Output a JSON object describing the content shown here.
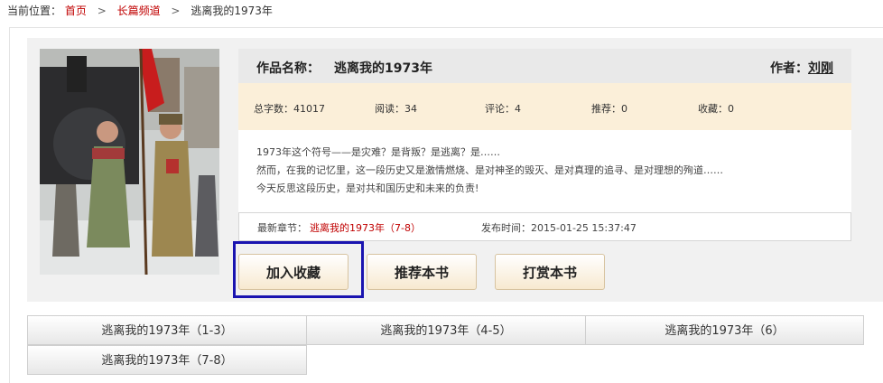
{
  "breadcrumb": {
    "label": "当前位置：",
    "home": "首页",
    "channel": "长篇频道",
    "separator": ">",
    "current": "逃离我的1973年"
  },
  "book": {
    "title_label": "作品名称：",
    "title": "逃离我的1973年",
    "author_label": "作者：",
    "author": "刘刚",
    "stats": [
      {
        "label": "总字数：",
        "value": "41017"
      },
      {
        "label": "阅读：",
        "value": "34"
      },
      {
        "label": "评论：",
        "value": "4"
      },
      {
        "label": "推荐：",
        "value": "0"
      },
      {
        "label": "收藏：",
        "value": "0"
      }
    ],
    "description": [
      "1973年这个符号——是灾难？是背叛？是逃离？是……",
      "然而，在我的记忆里，这一段历史又是激情燃烧、是对神圣的毁灭、是对真理的追寻、是对理想的殉道……",
      "今天反思这段历史，是对共和国历史和未来的负责!"
    ],
    "latest_label": "最新章节：",
    "latest_chapter": "逃离我的1973年（7-8）",
    "publish_label": "发布时间：",
    "publish_time": "2015-01-25 15:37:47"
  },
  "actions": {
    "favorite": "加入收藏",
    "recommend": "推荐本书",
    "tip": "打赏本书"
  },
  "chapters": [
    "逃离我的1973年（1-3）",
    "逃离我的1973年（4-5）",
    "逃离我的1973年（6）",
    "逃离我的1973年（7-8）"
  ]
}
